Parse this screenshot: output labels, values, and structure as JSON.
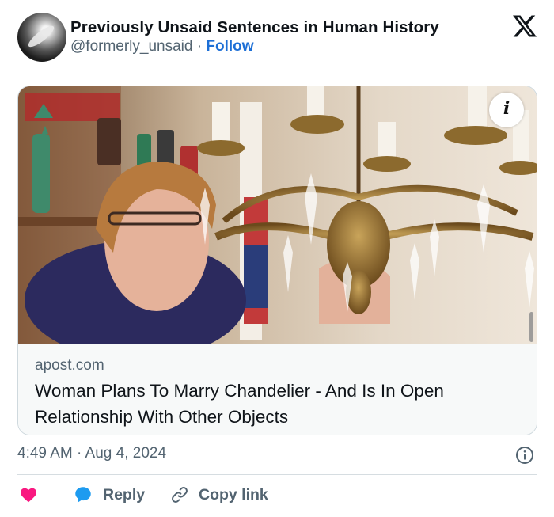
{
  "post": {
    "display_name": "Previously Unsaid Sentences in Human History",
    "handle": "@formerly_unsaid",
    "separator": "·",
    "follow_label": "Follow",
    "timestamp": "4:49 AM · Aug 4, 2024"
  },
  "card": {
    "domain": "apost.com",
    "title": "Woman Plans To Marry Chandelier - And Is In Open Relationship With Other Objects",
    "info_glyph": "i"
  },
  "actions": {
    "reply_label": "Reply",
    "copy_link_label": "Copy link"
  },
  "icons": {
    "logo": "x-logo-icon",
    "like": "heart-icon",
    "reply": "speech-bubble-icon",
    "copy": "link-icon",
    "info": "info-icon"
  },
  "colors": {
    "accent": "#1d6fd6",
    "like": "#f91880",
    "reply": "#1d9bf0",
    "muted": "#536471"
  }
}
